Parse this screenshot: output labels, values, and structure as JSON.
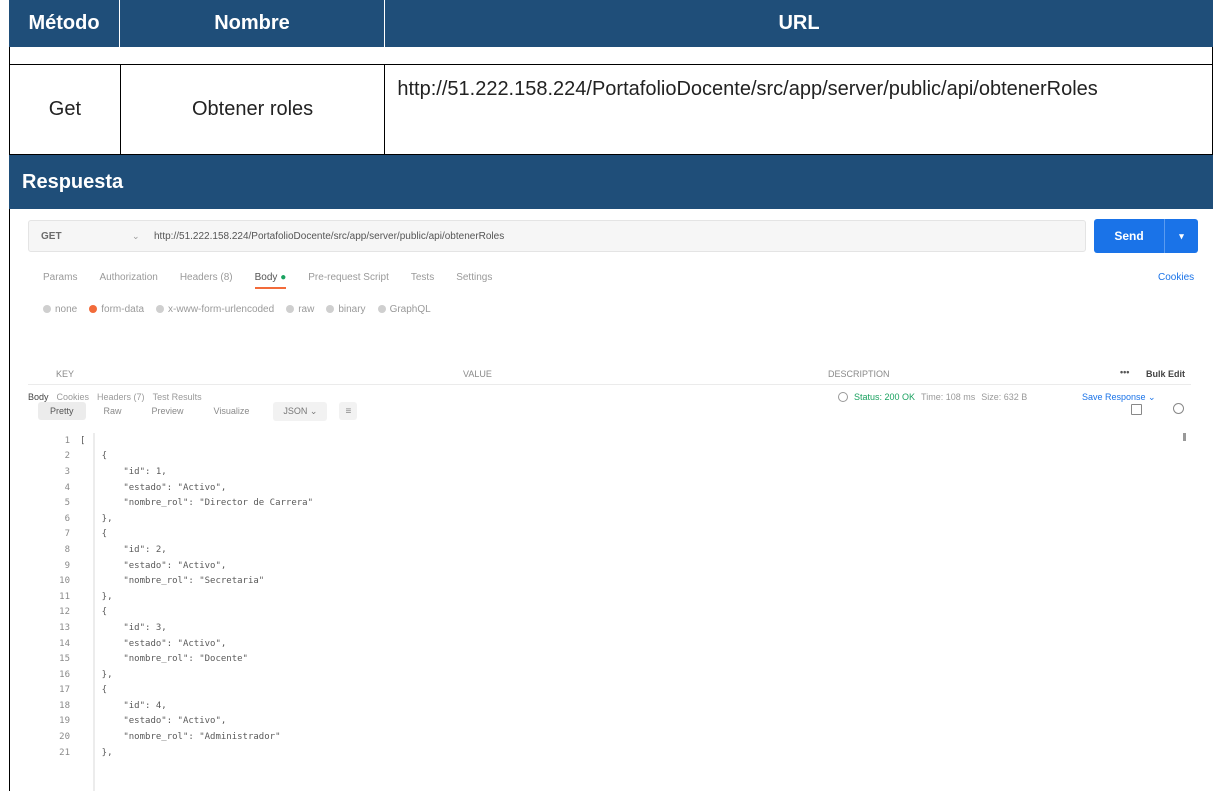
{
  "table": {
    "headers": [
      "Método",
      "Nombre",
      "URL"
    ],
    "row": {
      "method": "Get",
      "name": "Obtener roles",
      "url": "http://51.222.158.224/PortafolioDocente/src/app/server/public/api/obtenerRoles"
    },
    "response_title": "Respuesta"
  },
  "postman": {
    "method": "GET",
    "url": "http://51.222.158.224/PortafolioDocente/src/app/server/public/api/obtenerRoles",
    "send_label": "Send",
    "request_tabs": [
      "Params",
      "Authorization",
      "Headers (8)",
      "Body",
      "Pre-request Script",
      "Tests",
      "Settings"
    ],
    "active_request_tab": "Body",
    "cookies_label": "Cookies",
    "body_types": [
      "none",
      "form-data",
      "x-www-form-urlencoded",
      "raw",
      "binary",
      "GraphQL"
    ],
    "selected_body_type": "form-data",
    "kv_headers": {
      "key": "KEY",
      "value": "VALUE",
      "description": "DESCRIPTION",
      "more": "•••",
      "bulk_edit": "Bulk Edit"
    },
    "response_tabs": [
      "Body",
      "Cookies",
      "Headers (7)",
      "Test Results"
    ],
    "status": {
      "status": "Status: 200 OK",
      "time": "Time: 108 ms",
      "size": "Size: 632 B"
    },
    "save_response": "Save Response",
    "view_tabs": [
      "Pretty",
      "Raw",
      "Preview",
      "Visualize"
    ],
    "format": "JSON",
    "code_lines": [
      "[",
      "    {",
      "        \"id\": 1,",
      "        \"estado\": \"Activo\",",
      "        \"nombre_rol\": \"Director de Carrera\"",
      "    },",
      "    {",
      "        \"id\": 2,",
      "        \"estado\": \"Activo\",",
      "        \"nombre_rol\": \"Secretaria\"",
      "    },",
      "    {",
      "        \"id\": 3,",
      "        \"estado\": \"Activo\",",
      "        \"nombre_rol\": \"Docente\"",
      "    },",
      "    {",
      "        \"id\": 4,",
      "        \"estado\": \"Activo\",",
      "        \"nombre_rol\": \"Administrador\"",
      "    },"
    ]
  },
  "colors": {
    "header_bg": "#1f4e79",
    "send_button": "#1a73e8",
    "active_tab_underline": "#f26b3a",
    "status_ok": "#1aa260"
  }
}
